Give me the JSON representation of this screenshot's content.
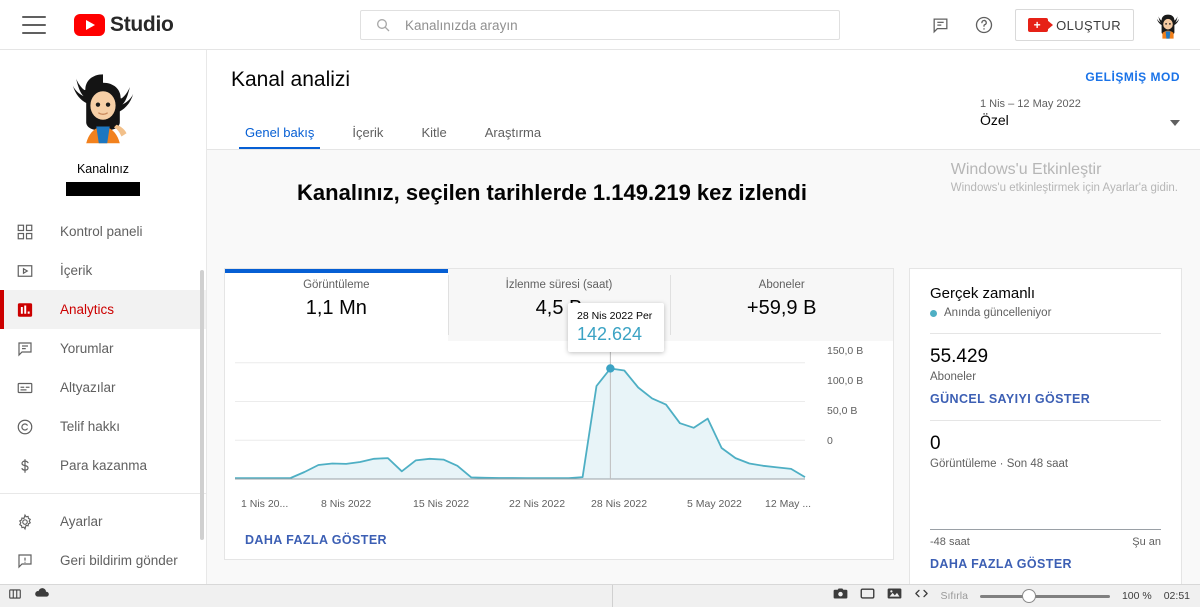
{
  "topbar": {
    "menu_icon": "hamburger-icon",
    "brand": "Studio",
    "search": {
      "placeholder": "Kanalınızda arayın",
      "value": ""
    },
    "feedback_icon": "comment-icon",
    "help_icon": "help-icon",
    "create_label": "OLUŞTUR",
    "avatar_alt": "Kanalınız"
  },
  "sidebar": {
    "channel_name": "Kanalınız",
    "items": [
      {
        "label": "Kontrol paneli",
        "icon": "dashboard-icon"
      },
      {
        "label": "İçerik",
        "icon": "video-icon"
      },
      {
        "label": "Analytics",
        "icon": "analytics-icon",
        "active": true
      },
      {
        "label": "Yorumlar",
        "icon": "comment-icon"
      },
      {
        "label": "Altyazılar",
        "icon": "subtitles-icon"
      },
      {
        "label": "Telif hakkı",
        "icon": "copyright-icon"
      },
      {
        "label": "Para kazanma",
        "icon": "dollar-icon"
      }
    ],
    "footer_items": [
      {
        "label": "Ayarlar",
        "icon": "gear-icon"
      },
      {
        "label": "Geri bildirim gönder",
        "icon": "feedback-icon"
      }
    ]
  },
  "main": {
    "page_title": "Kanal analizi",
    "advanced_mode": "GELİŞMİŞ MOD",
    "date_range": {
      "range": "1 Nis – 12 May 2022",
      "preset": "Özel"
    },
    "tabs": [
      {
        "label": "Genel bakış",
        "active": true
      },
      {
        "label": "İçerik",
        "active": false
      },
      {
        "label": "Kitle",
        "active": false
      },
      {
        "label": "Araştırma",
        "active": false
      }
    ],
    "headline": "Kanalınız, seçilen tarihlerde 1.149.219 kez izlendi",
    "metrics": [
      {
        "label": "Görüntüleme",
        "value": "1,1 Mn",
        "selected": true
      },
      {
        "label": "İzlenme süresi (saat)",
        "value": "4,5 B",
        "selected": false
      },
      {
        "label": "Aboneler",
        "value": "+59,9 B",
        "selected": false
      }
    ],
    "tooltip": {
      "date": "28 Nis 2022 Per",
      "value": "142.624"
    },
    "show_more": "DAHA FAZLA GÖSTER"
  },
  "realtime": {
    "title": "Gerçek zamanlı",
    "live_status": "Anında güncelleniyor",
    "subscribers": {
      "value": "55.429",
      "label": "Aboneler",
      "link": "GÜNCEL SAYIYI GÖSTER"
    },
    "views": {
      "value": "0",
      "label": "Görüntüleme · Son 48 saat"
    },
    "axis_left": "-48 saat",
    "axis_right": "Şu an",
    "link": "DAHA FAZLA GÖSTER"
  },
  "watermark": {
    "line1": "Windows'u Etkinleştir",
    "line2": "Windows'u etkinleştirmek için Ayarlar'a gidin."
  },
  "taskbar": {
    "left_icons": [
      "layout-icon",
      "cloud-icon"
    ],
    "right_icons": [
      "camera-icon",
      "window-icon",
      "image-icon",
      "code-icon"
    ],
    "reset_label": "Sıfırla",
    "zoom": "100 %",
    "time": "02:51"
  },
  "colors": {
    "brand_red": "#ff0000",
    "accent_blue": "#065fd4",
    "link_blue": "#3c5fb4",
    "chart_line": "#4eafc4",
    "chart_fill": "#e6f3f7",
    "active_red": "#cc0000"
  },
  "chart_data": {
    "type": "area",
    "title": "Görüntüleme",
    "xlabel": "",
    "ylabel": "",
    "ylim": [
      0,
      160000
    ],
    "yticks": [
      "0",
      "50,0 B",
      "100,0 B",
      "150,0 B"
    ],
    "ytick_values": [
      0,
      50000,
      100000,
      150000
    ],
    "xticks": [
      "1 Nis 20...",
      "8 Nis 2022",
      "15 Nis 2022",
      "22 Nis 2022",
      "28 Nis 2022",
      "5 May 2022",
      "12 May ..."
    ],
    "grid": true,
    "legend": "none",
    "highlight": {
      "x": "28 Nis 2022 Per",
      "y": 142624
    },
    "x": [
      "1 Nis",
      "2 Nis",
      "3 Nis",
      "4 Nis",
      "5 Nis",
      "6 Nis",
      "7 Nis",
      "8 Nis",
      "9 Nis",
      "10 Nis",
      "11 Nis",
      "12 Nis",
      "13 Nis",
      "14 Nis",
      "15 Nis",
      "16 Nis",
      "17 Nis",
      "18 Nis",
      "19 Nis",
      "20 Nis",
      "21 Nis",
      "22 Nis",
      "23 Nis",
      "24 Nis",
      "25 Nis",
      "26 Nis",
      "27 Nis",
      "28 Nis",
      "29 Nis",
      "30 Nis",
      "1 May",
      "2 May",
      "3 May",
      "4 May",
      "5 May",
      "6 May",
      "7 May",
      "8 May",
      "9 May",
      "10 May",
      "11 May",
      "12 May"
    ],
    "values": [
      1200,
      1200,
      1200,
      1200,
      1300,
      9000,
      18000,
      20000,
      19500,
      22000,
      26000,
      27000,
      10000,
      24000,
      26000,
      25000,
      17000,
      2000,
      1500,
      1300,
      1300,
      1200,
      1200,
      1200,
      1200,
      2500,
      120000,
      142624,
      140000,
      118000,
      104000,
      96000,
      72000,
      66000,
      78000,
      40000,
      27000,
      20000,
      17000,
      15000,
      13000,
      2500
    ]
  },
  "realtime_chart": {
    "type": "line",
    "values": [
      0,
      0,
      0,
      0,
      0,
      0,
      0,
      0,
      0,
      0,
      0,
      0
    ],
    "ylim": [
      0,
      1
    ]
  }
}
